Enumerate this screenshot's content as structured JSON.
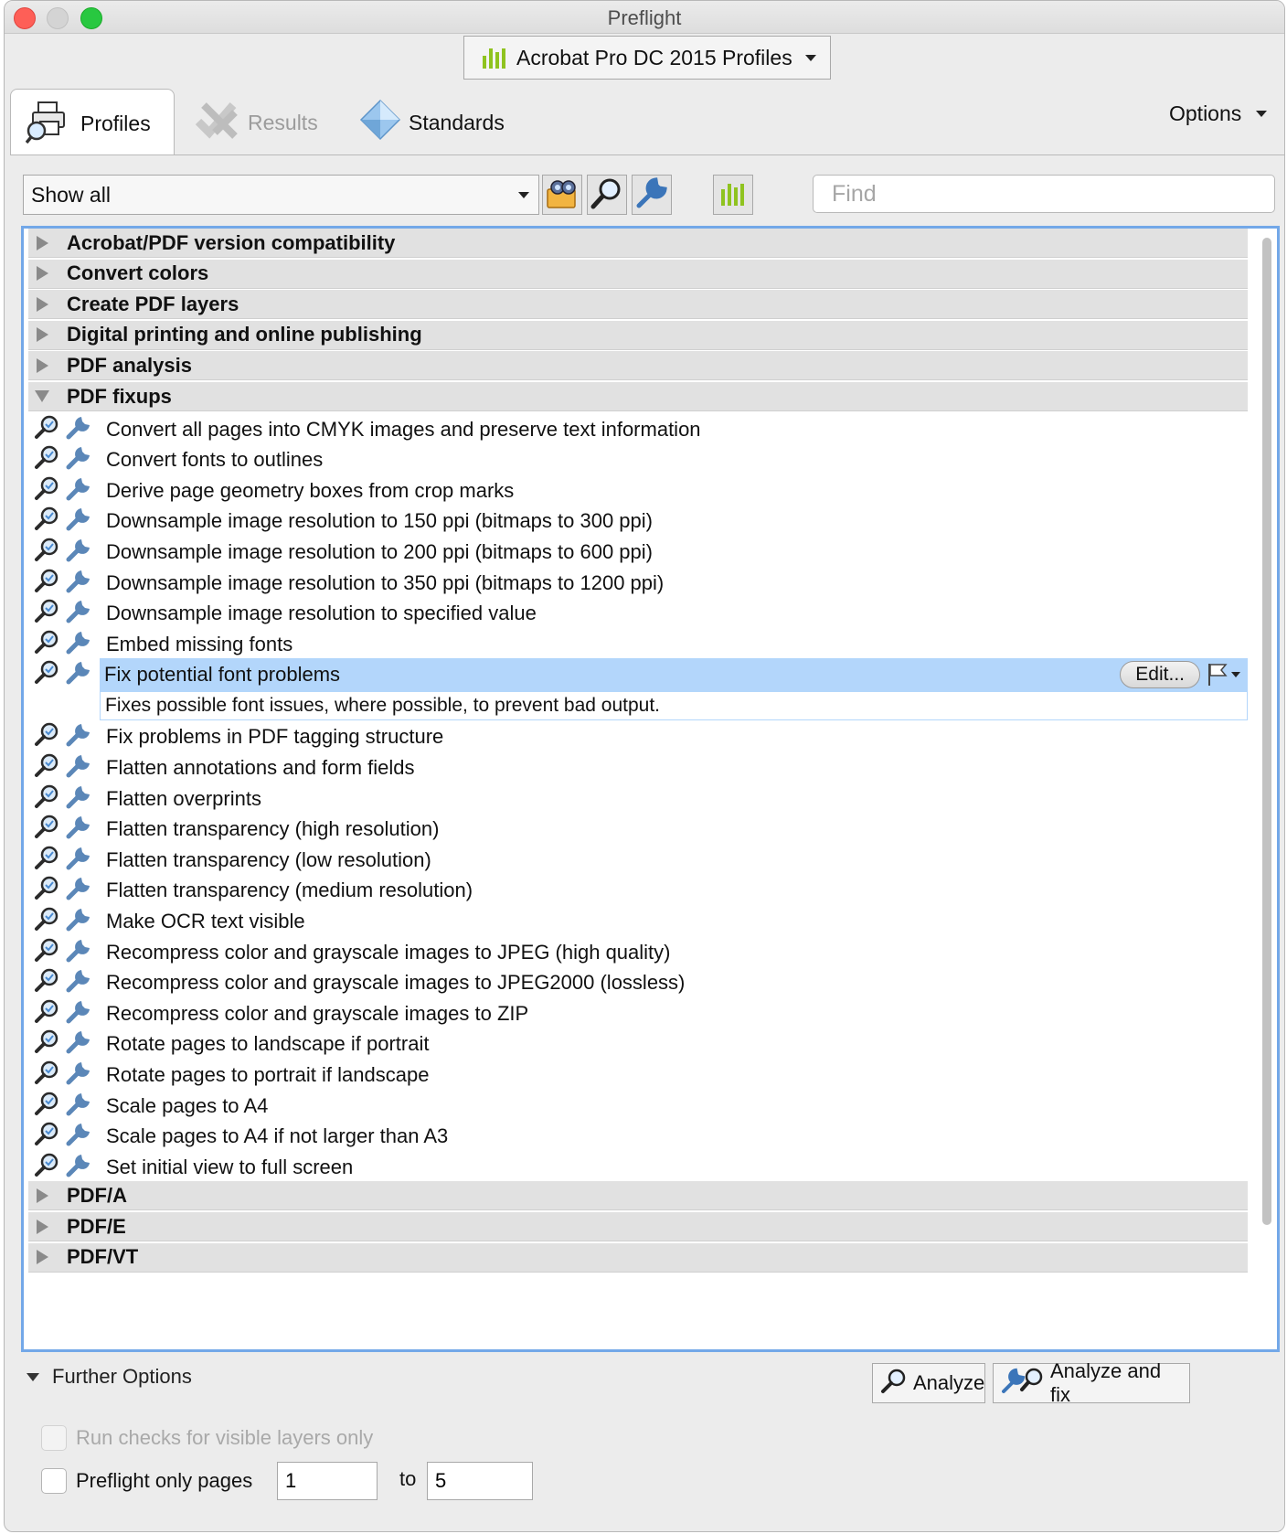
{
  "window": {
    "title": "Preflight"
  },
  "profiles_dropdown": {
    "label": "Acrobat Pro DC 2015 Profiles",
    "icon": "bars-chart-icon"
  },
  "tabs": [
    {
      "label": "Profiles",
      "icon": "printer-magnifier-icon",
      "state": "active"
    },
    {
      "label": "Results",
      "icon": "checkmark-x-icon",
      "state": "disabled"
    },
    {
      "label": "Standards",
      "icon": "diamond-icon",
      "state": "normal"
    }
  ],
  "options": {
    "label": "Options"
  },
  "filter": {
    "value": "Show all"
  },
  "toolbar": {
    "icons": [
      "binoculars-folder-icon",
      "magnifier-icon",
      "wrench-icon",
      "bars-chart-icon"
    ]
  },
  "search": {
    "placeholder": "Find"
  },
  "groups_top": [
    {
      "label": "Acrobat/PDF version compatibility",
      "expanded": false
    },
    {
      "label": "Convert colors",
      "expanded": false
    },
    {
      "label": "Create PDF layers",
      "expanded": false
    },
    {
      "label": "Digital printing and online publishing",
      "expanded": false
    },
    {
      "label": "PDF analysis",
      "expanded": false
    },
    {
      "label": "PDF fixups",
      "expanded": true
    }
  ],
  "fixups": [
    {
      "label": "Convert all pages into CMYK images and preserve text information"
    },
    {
      "label": "Convert fonts to outlines"
    },
    {
      "label": "Derive page geometry boxes from crop marks"
    },
    {
      "label": "Downsample image resolution to 150 ppi (bitmaps to 300 ppi)"
    },
    {
      "label": "Downsample image resolution to 200 ppi (bitmaps to 600 ppi)"
    },
    {
      "label": "Downsample image resolution to 350 ppi (bitmaps to 1200 ppi)"
    },
    {
      "label": "Downsample image resolution to specified value"
    },
    {
      "label": "Embed missing fonts"
    },
    {
      "label": "Fix potential font problems",
      "selected": true,
      "description": "Fixes possible font issues, where possible, to prevent bad output.",
      "edit_label": "Edit..."
    },
    {
      "label": "Fix problems in PDF tagging structure"
    },
    {
      "label": "Flatten annotations and form fields"
    },
    {
      "label": "Flatten overprints"
    },
    {
      "label": "Flatten transparency (high resolution)"
    },
    {
      "label": "Flatten transparency (low resolution)"
    },
    {
      "label": "Flatten transparency (medium resolution)"
    },
    {
      "label": "Make OCR text visible"
    },
    {
      "label": "Recompress color and grayscale images to JPEG (high quality)"
    },
    {
      "label": "Recompress color and grayscale images to JPEG2000 (lossless)"
    },
    {
      "label": "Recompress color and grayscale images to ZIP"
    },
    {
      "label": "Rotate pages to landscape if portrait"
    },
    {
      "label": "Rotate pages to portrait if landscape"
    },
    {
      "label": "Scale pages to A4"
    },
    {
      "label": "Scale pages to A4 if not larger than A3"
    },
    {
      "label": "Set initial view to full screen"
    }
  ],
  "groups_bottom": [
    {
      "label": "PDF/A",
      "expanded": false
    },
    {
      "label": "PDF/E",
      "expanded": false
    },
    {
      "label": "PDF/VT",
      "expanded": false
    }
  ],
  "further_options": {
    "label": "Further Options"
  },
  "actions": {
    "analyze": "Analyze",
    "analyze_fix": "Analyze and fix"
  },
  "checks": {
    "visible_layers": "Run checks for visible layers only",
    "pages": "Preflight only pages",
    "from": "1",
    "to_label": "to",
    "to": "5"
  },
  "colors": {
    "selection": "#b3d6fb",
    "focus_border": "#73a8e8",
    "accent_green": "#8fc31f"
  }
}
